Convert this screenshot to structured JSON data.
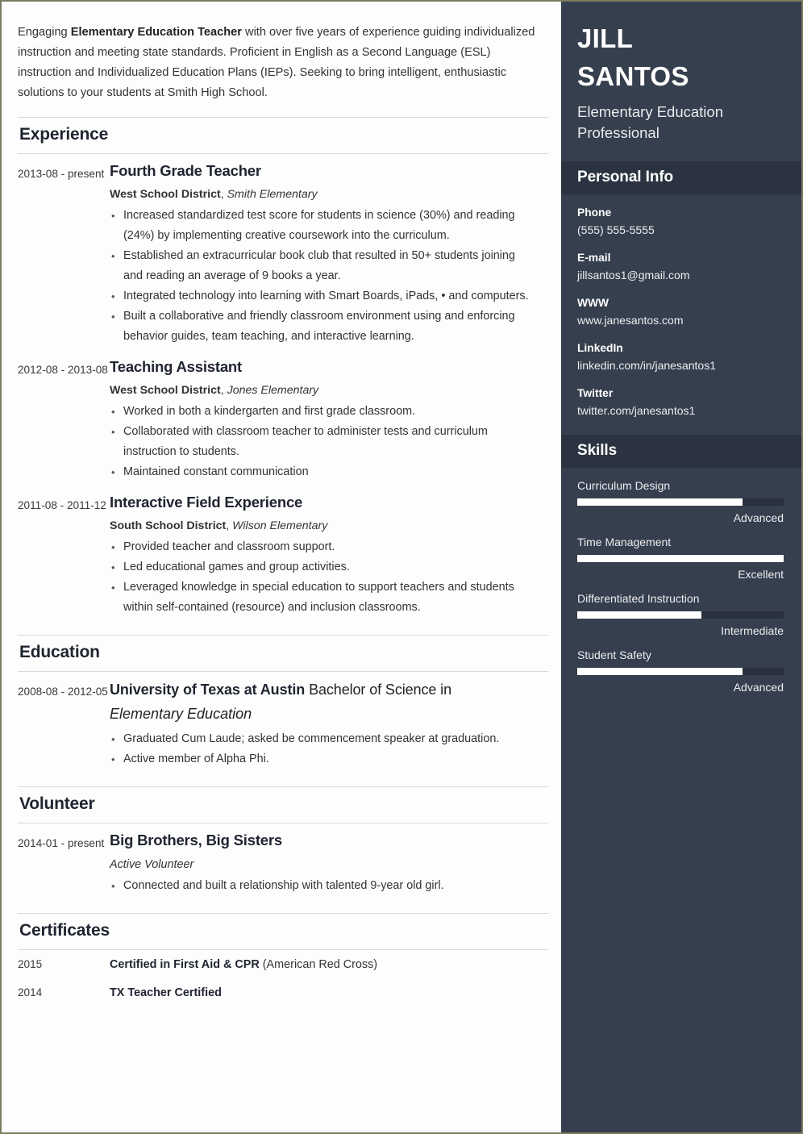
{
  "summary": {
    "pre": "Engaging ",
    "bold": "Elementary Education Teacher",
    "post": " with over five years of experience guiding individualized instruction and meeting state standards. Proficient in English as a Second Language (ESL) instruction and Individualized Education Plans (IEPs). Seeking to bring intelligent, enthusiastic solutions to your students at Smith High School."
  },
  "sections": {
    "experience": "Experience",
    "education": "Education",
    "volunteer": "Volunteer",
    "certificates": "Certificates"
  },
  "experience": [
    {
      "dates": "2013-08 - present",
      "title": "Fourth Grade Teacher",
      "org": "West School District",
      "org_sep": ", ",
      "sub": "Smith Elementary",
      "bullets": [
        "Increased standardized test score for students in science (30%) and reading (24%) by implementing creative coursework into the curriculum.",
        "Established an extracurricular book club that resulted in 50+ students joining and reading an average of 9 books a year.",
        "Integrated technology into learning with Smart Boards, iPads, • and computers.",
        "Built a collaborative and friendly classroom environment using and enforcing behavior guides, team teaching, and interactive learning."
      ]
    },
    {
      "dates": "2012-08 - 2013-08",
      "title": "Teaching Assistant",
      "org": "West School District",
      "org_sep": ", ",
      "sub": "Jones Elementary",
      "bullets": [
        "Worked in both a kindergarten and first grade classroom.",
        "Collaborated with classroom teacher to administer tests and curriculum instruction to students.",
        "Maintained constant communication"
      ]
    },
    {
      "dates": "2011-08 - 2011-12",
      "title": "Interactive Field Experience",
      "org": "South School District",
      "org_sep": ", ",
      "sub": "Wilson Elementary",
      "bullets": [
        "Provided teacher and classroom support.",
        "Led educational games and group activities.",
        "Leveraged knowledge in special education to support teachers and students within self-contained (resource) and inclusion classrooms."
      ]
    }
  ],
  "education": [
    {
      "dates": "2008-08 - 2012-05",
      "school": "University of Texas at Austin",
      "degree": " Bachelor of Science in",
      "field": "Elementary Education",
      "bullets": [
        "Graduated Cum Laude; asked be commencement speaker at graduation.",
        "Active member of Alpha Phi."
      ]
    }
  ],
  "volunteer": [
    {
      "dates": "2014-01 - present",
      "title": "Big Brothers, Big Sisters",
      "role": "Active Volunteer",
      "bullets": [
        "Connected and built a relationship with talented 9-year old girl."
      ]
    }
  ],
  "certificates": [
    {
      "year": "2015",
      "name": "Certified in First Aid & CPR",
      "detail": " (American Red Cross)"
    },
    {
      "year": "2014",
      "name": "TX Teacher Certified",
      "detail": ""
    }
  ],
  "sidebar": {
    "name_line1": "JILL",
    "name_line2": "SANTOS",
    "subtitle": "Elementary Education Professional",
    "personal_info_head": "Personal Info",
    "skills_head": "Skills",
    "info": [
      {
        "label": "Phone",
        "value": "(555) 555-5555"
      },
      {
        "label": "E-mail",
        "value": "jillsantos1@gmail.com"
      },
      {
        "label": "WWW",
        "value": "www.janesantos.com"
      },
      {
        "label": "LinkedIn",
        "value": "linkedin.com/in/janesantos1"
      },
      {
        "label": "Twitter",
        "value": "twitter.com/janesantos1"
      }
    ],
    "skills": [
      {
        "name": "Curriculum Design",
        "level": "Advanced",
        "percent": 80
      },
      {
        "name": "Time Management",
        "level": "Excellent",
        "percent": 100
      },
      {
        "name": "Differentiated Instruction",
        "level": "Intermediate",
        "percent": 60
      },
      {
        "name": "Student Safety",
        "level": "Advanced",
        "percent": 80
      }
    ]
  },
  "colors": {
    "sidebar_bg": "#363f4d",
    "sidebar_head_bg": "#2b3340",
    "page_border": "#7c7c60",
    "rule": "#d8d8d8",
    "skill_track": "#2a313d",
    "skill_fill": "#ffffff"
  }
}
